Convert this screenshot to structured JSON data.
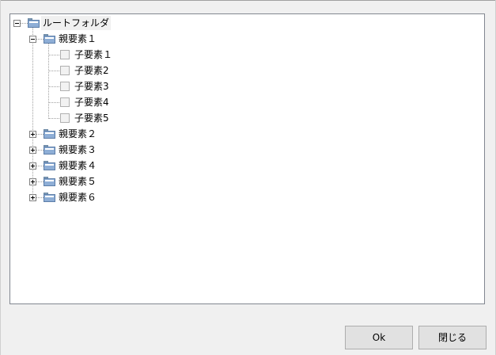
{
  "tree": {
    "root": {
      "label": "ルートフォルダ",
      "expanded": true,
      "icon": "folder-icon"
    },
    "parents": [
      {
        "label": "親要素１",
        "expanded": true,
        "icon": "folder-icon",
        "children": [
          {
            "label": "子要素１",
            "icon": "document-icon"
          },
          {
            "label": "子要素2",
            "icon": "document-icon"
          },
          {
            "label": "子要素3",
            "icon": "document-icon"
          },
          {
            "label": "子要素4",
            "icon": "document-icon"
          },
          {
            "label": "子要素5",
            "icon": "document-icon"
          }
        ]
      },
      {
        "label": "親要素２",
        "expanded": false,
        "icon": "folder-icon"
      },
      {
        "label": "親要素３",
        "expanded": false,
        "icon": "folder-icon"
      },
      {
        "label": "親要素４",
        "expanded": false,
        "icon": "folder-icon"
      },
      {
        "label": "親要素５",
        "expanded": false,
        "icon": "folder-icon"
      },
      {
        "label": "親要素６",
        "expanded": false,
        "icon": "folder-icon"
      }
    ]
  },
  "buttons": {
    "ok_label": "Ok",
    "close_label": "閉じる"
  },
  "colors": {
    "panel_background": "#ffffff",
    "window_background": "#f0f0f0",
    "folder_blue": "#8eaed6",
    "button_face": "#e1e1e1"
  }
}
